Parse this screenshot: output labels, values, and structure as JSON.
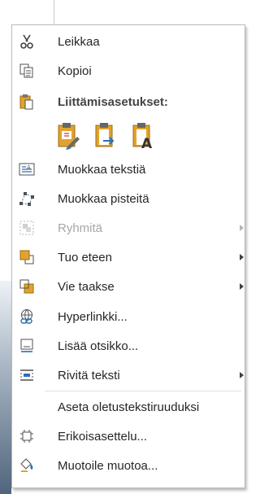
{
  "menu": {
    "cut": {
      "label": "Leikkaa",
      "icon": "scissors-icon"
    },
    "copy": {
      "label": "Kopioi",
      "icon": "copy-icon"
    },
    "paste_header": {
      "label": "Liittämisasetukset:",
      "icon": "clipboard-icon"
    },
    "paste_options": [
      {
        "name": "paste-use-destination-theme",
        "icon": "paste-destination-theme-icon"
      },
      {
        "name": "paste-picture",
        "icon": "paste-picture-icon"
      },
      {
        "name": "paste-keep-text-only",
        "icon": "paste-text-only-icon"
      }
    ],
    "edit_text": {
      "label": "Muokkaa tekstiä",
      "icon": "edit-text-icon"
    },
    "edit_points": {
      "label": "Muokkaa pisteitä",
      "icon": "edit-points-icon"
    },
    "group": {
      "label": "Ryhmitä",
      "icon": "group-icon",
      "disabled": true
    },
    "bring_front": {
      "label": "Tuo eteen",
      "icon": "bring-to-front-icon"
    },
    "send_back": {
      "label": "Vie taakse",
      "icon": "send-to-back-icon"
    },
    "hyperlink": {
      "label": "Hyperlinkki...",
      "icon": "hyperlink-icon"
    },
    "caption": {
      "label": "Lisää otsikko...",
      "icon": "insert-caption-icon"
    },
    "wrap_text": {
      "label": "Rivitä teksti",
      "icon": "wrap-text-icon"
    },
    "default_textbox": {
      "label": "Aseta oletustekstiruuduksi"
    },
    "more_layout": {
      "label": "Erikoisasettelu...",
      "icon": "layout-options-icon"
    },
    "format_shape": {
      "label": "Muotoile muotoa...",
      "icon": "format-shape-icon"
    }
  },
  "colors": {
    "accent_orange": "#e1a32d",
    "accent_blue": "#2e6fb6",
    "disabled": "#a6a6a6"
  }
}
